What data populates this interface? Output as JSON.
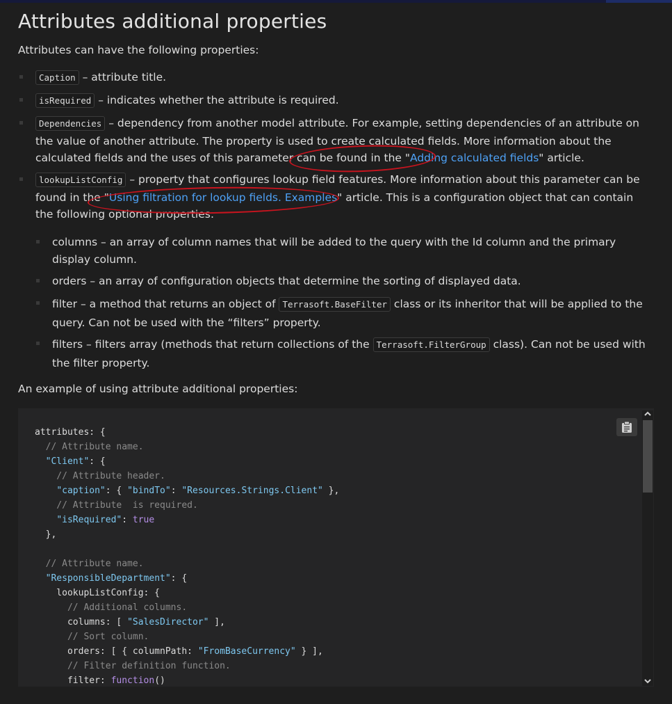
{
  "page": {
    "title": "Attributes additional properties",
    "intro": "Attributes can have the following properties:",
    "example_intro": "An example of using attribute additional properties:"
  },
  "properties": [
    {
      "code": "Caption",
      "text": " – attribute title."
    },
    {
      "code": "isRequired",
      "text": " – indicates whether the attribute is required."
    },
    {
      "code": "Dependencies",
      "text_before_link": " – dependency from another model attribute. For example, setting dependencies of an attribute on the value of another attribute. The property is used to create calculated fields. More information about the calculated fields and the uses of this parameter can be found in the \"",
      "link": "Adding calculated fields",
      "text_after_link": "\" article."
    },
    {
      "code": "lookupListConfig",
      "text_before_link": " – property that configures lookup field features. More information about this parameter can be found in the \"",
      "link": "Using filtration for lookup fields. Examples",
      "text_after_link": "\" article. This is a configuration object that can contain the following optional properties:"
    }
  ],
  "sub_properties": [
    {
      "text": "columns – an array of column names that will be added to the query with the Id column and the primary display column."
    },
    {
      "text": "orders – an array of configuration objects that determine the sorting of displayed data."
    },
    {
      "text_before": "filter – a method that returns an object of ",
      "code": "Terrasoft.BaseFilter",
      "text_after": " class or its inheritor that will be applied to the query. Can not be used with the “filters” property."
    },
    {
      "text_before": "filters – filters array (methods that return collections of the ",
      "code": "Terrasoft.FilterGroup",
      "text_after": " class). Can not be used with the filter property."
    }
  ],
  "code_sample": {
    "lines": [
      "attributes: {",
      "  // Attribute name.",
      "  \"Client\": {",
      "    // Attribute header.",
      "    \"caption\": { \"bindTo\": \"Resources.Strings.Client\" },",
      "    // Attribute  is required.",
      "    \"isRequired\": true",
      "  },",
      "",
      "  // Attribute name.",
      "  \"ResponsibleDepartment\": {",
      "    lookupListConfig: {",
      "      // Additional columns.",
      "      columns: [ \"SalesDirector\" ],",
      "      // Sort column.",
      "      orders: [ { columnPath: \"FromBaseCurrency\" } ],",
      "      // Filter definition function.",
      "      filter: function()"
    ]
  },
  "icons": {
    "copy": "clipboard-icon",
    "scroll_up": "chevron-up-icon",
    "scroll_down": "chevron-down-icon"
  },
  "colors": {
    "background": "#1e1e1e",
    "link": "#4ea1f5",
    "annotation": "#c8141e",
    "string": "#7ec8f0",
    "keyword": "#b48ee6",
    "comment": "#8a8a8a"
  }
}
